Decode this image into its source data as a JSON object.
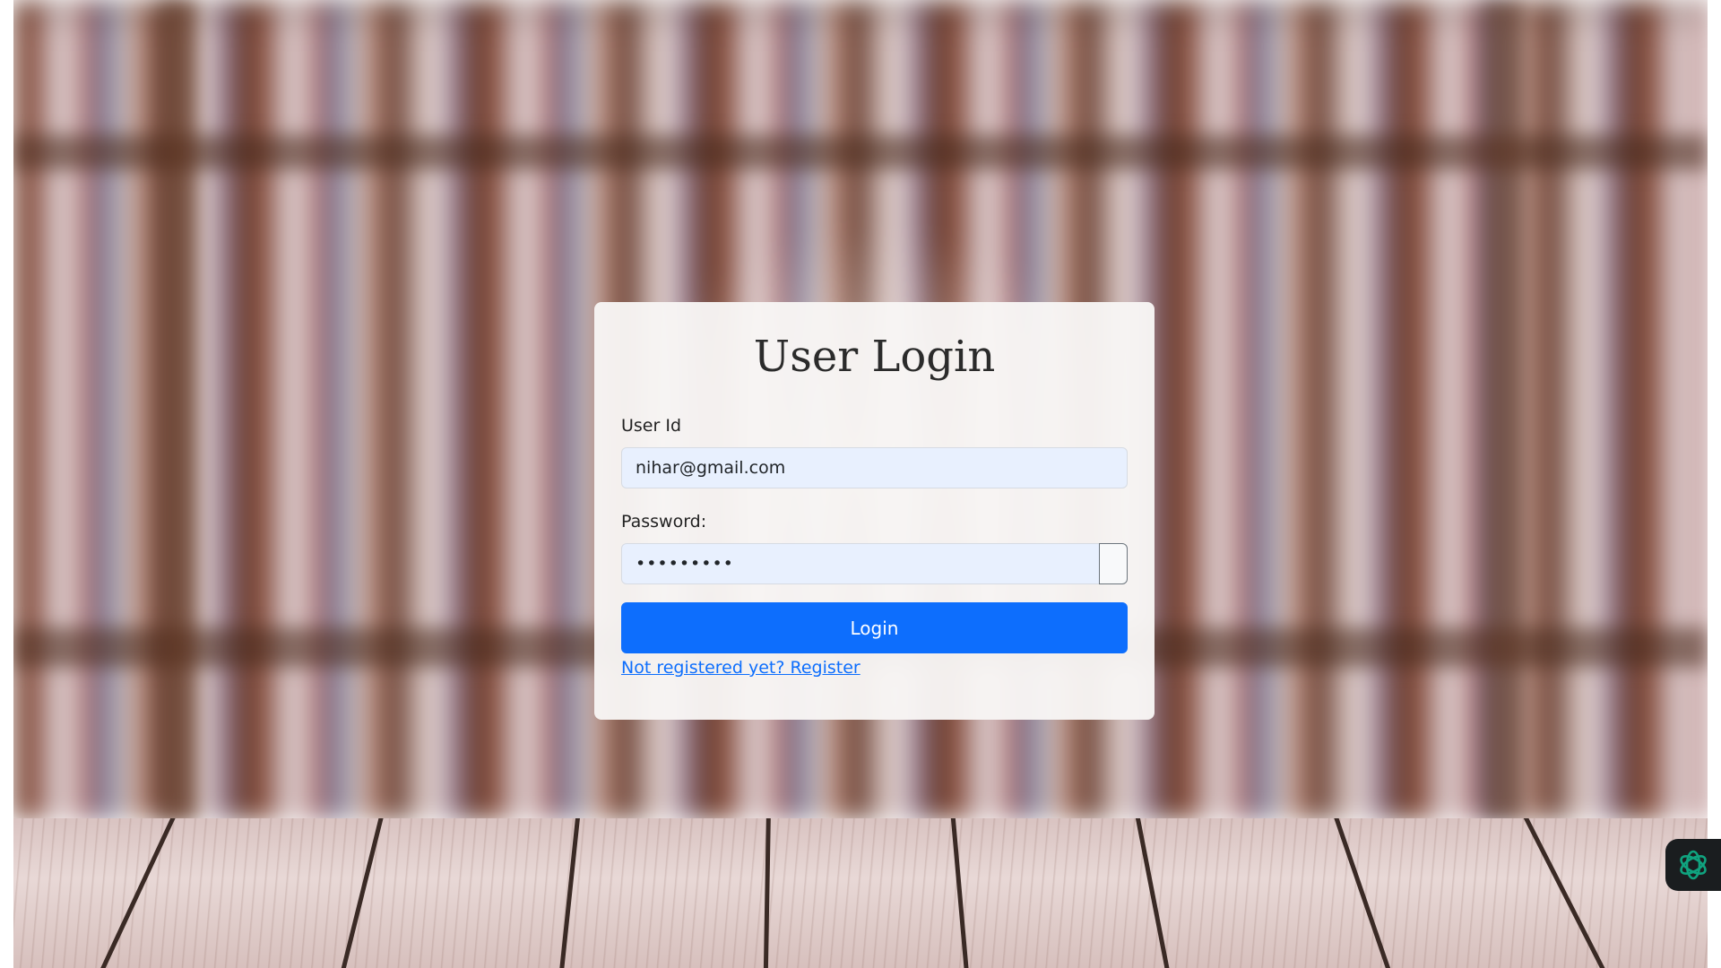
{
  "login_card": {
    "title": "User Login",
    "user_id_label": "User Id",
    "user_id_value": "nihar@gmail.com",
    "password_label": "Password:",
    "password_value": "•••••••••",
    "login_button_label": "Login",
    "register_link_text": "Not registered yet? Register"
  },
  "colors": {
    "primary_button": "#0d6efd",
    "input_autofill_bg": "#e8f0fe",
    "widget_bg": "#1a1d1f",
    "widget_icon": "#10a37f"
  },
  "icons": {
    "assistant_widget": "openai-knot-icon"
  }
}
